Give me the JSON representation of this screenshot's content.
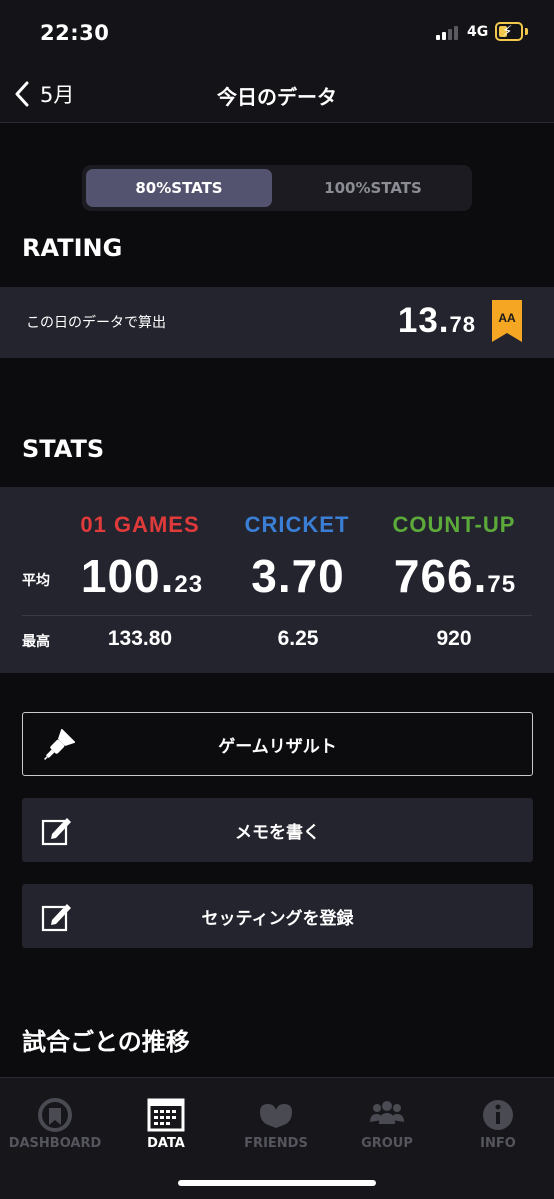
{
  "status_bar": {
    "time": "22:30",
    "network": "4G",
    "icons": [
      "signal-icon",
      "battery-charging-icon"
    ]
  },
  "nav": {
    "back_label": "5月",
    "title": "今日のデータ"
  },
  "segmented": {
    "options": [
      "80%STATS",
      "100%STATS"
    ],
    "selected": "80%STATS"
  },
  "rating": {
    "section_title": "RATING",
    "label": "この日のデータで算出",
    "value_main": "13.",
    "value_small": "78",
    "badge": "AA",
    "badge_color": "#f5a623"
  },
  "stats": {
    "section_title": "STATS",
    "row_labels": {
      "avg": "平均",
      "max": "最高"
    },
    "columns": [
      {
        "name": "01 GAMES",
        "color": "#e03a3a",
        "avg_main": "100.",
        "avg_small": "23",
        "max": "133.80"
      },
      {
        "name": "CRICKET",
        "color": "#3a7fd5",
        "avg_main": "3.70",
        "avg_small": "",
        "max": "6.25"
      },
      {
        "name": "COUNT-UP",
        "color": "#5caa3a",
        "avg_main": "766.",
        "avg_small": "75",
        "max": "920"
      }
    ]
  },
  "actions": [
    {
      "label": "ゲームリザルト",
      "icon": "dart-icon"
    },
    {
      "label": "メモを書く",
      "icon": "edit-icon"
    },
    {
      "label": "セッティングを登録",
      "icon": "edit-icon"
    }
  ],
  "trend": {
    "section_title": "試合ごとの推移"
  },
  "tab_bar": {
    "tabs": [
      {
        "label": "DASHBOARD",
        "icon": "dashboard-icon"
      },
      {
        "label": "DATA",
        "icon": "calendar-icon",
        "active": true
      },
      {
        "label": "FRIENDS",
        "icon": "friends-icon"
      },
      {
        "label": "GROUP",
        "icon": "group-icon"
      },
      {
        "label": "INFO",
        "icon": "info-icon"
      }
    ]
  },
  "colors": {
    "background": "#0c0c0f",
    "panel": "#24242f",
    "segment_active": "#53536f"
  }
}
